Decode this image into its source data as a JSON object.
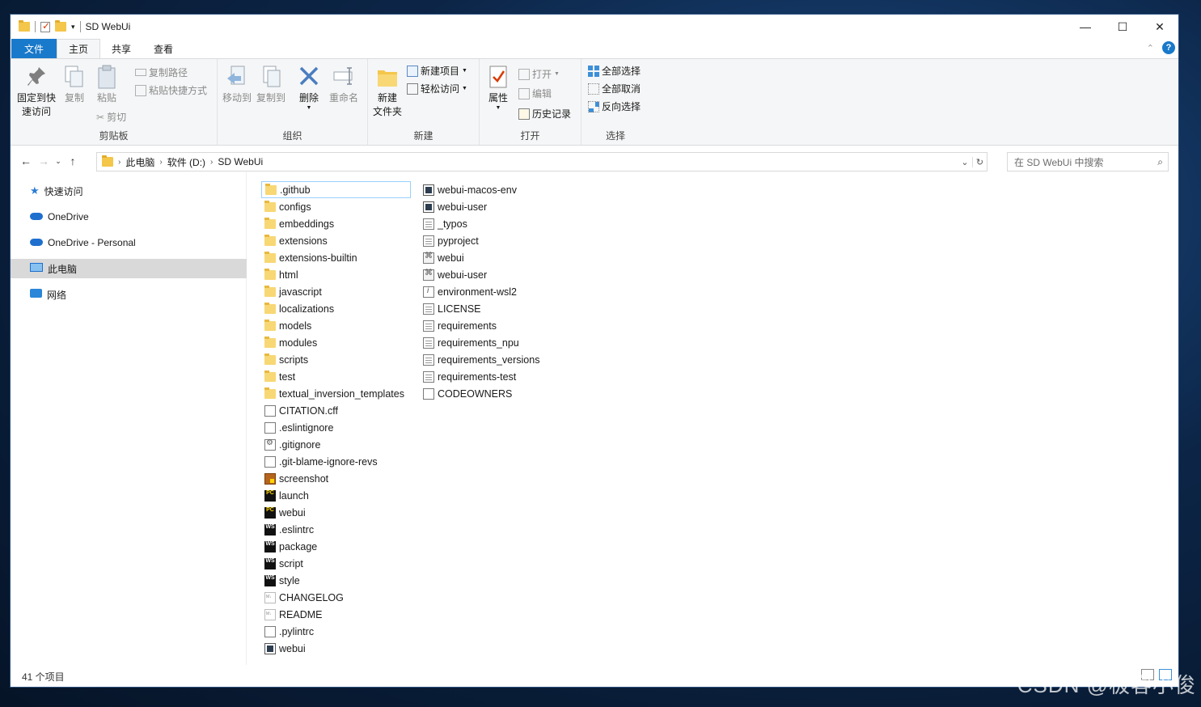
{
  "window": {
    "title": "SD WebUi",
    "controls": {
      "minimize": "—",
      "maximize": "☐",
      "close": "✕"
    }
  },
  "ribbon_tabs": [
    "文件",
    "主页",
    "共享",
    "查看"
  ],
  "ribbon": {
    "clipboard": {
      "pin": "固定到快速访问",
      "copy": "复制",
      "paste": "粘贴",
      "copy_path": "复制路径",
      "paste_shortcut": "粘贴快捷方式",
      "cut": "剪切",
      "label": "剪贴板"
    },
    "organize": {
      "move_to": "移动到",
      "copy_to": "复制到",
      "delete": "删除",
      "rename": "重命名",
      "label": "组织"
    },
    "new": {
      "new_folder_line1": "新建",
      "new_folder_line2": "文件夹",
      "new_item": "新建项目",
      "easy_access": "轻松访问",
      "label": "新建"
    },
    "open": {
      "properties": "属性",
      "open": "打开",
      "edit": "编辑",
      "history": "历史记录",
      "label": "打开"
    },
    "select": {
      "select_all": "全部选择",
      "select_none": "全部取消",
      "invert": "反向选择",
      "label": "选择"
    }
  },
  "address": {
    "crumbs": [
      "此电脑",
      "软件 (D:)",
      "SD WebUi"
    ],
    "search_placeholder": "在 SD WebUi 中搜索"
  },
  "nav_pane": [
    {
      "label": "快速访问",
      "icon": "star-icon"
    },
    {
      "label": "OneDrive",
      "icon": "cloud-icon"
    },
    {
      "label": "OneDrive - Personal",
      "icon": "cloud-icon"
    },
    {
      "label": "此电脑",
      "icon": "computer-icon",
      "selected": true
    },
    {
      "label": "网络",
      "icon": "network-icon"
    }
  ],
  "files_col1": [
    {
      "name": ".github",
      "type": "folder",
      "selected": true
    },
    {
      "name": "configs",
      "type": "folder"
    },
    {
      "name": "embeddings",
      "type": "folder"
    },
    {
      "name": "extensions",
      "type": "folder"
    },
    {
      "name": "extensions-builtin",
      "type": "folder"
    },
    {
      "name": "html",
      "type": "folder"
    },
    {
      "name": "javascript",
      "type": "folder"
    },
    {
      "name": "localizations",
      "type": "folder"
    },
    {
      "name": "models",
      "type": "folder"
    },
    {
      "name": "modules",
      "type": "folder"
    },
    {
      "name": "scripts",
      "type": "folder"
    },
    {
      "name": "test",
      "type": "folder"
    },
    {
      "name": "textual_inversion_templates",
      "type": "folder"
    },
    {
      "name": "CITATION.cff",
      "type": "blank"
    },
    {
      "name": ".eslintignore",
      "type": "blank"
    },
    {
      "name": ".gitignore",
      "type": "gear"
    },
    {
      "name": ".git-blame-ignore-revs",
      "type": "blank"
    },
    {
      "name": "screenshot",
      "type": "pic"
    },
    {
      "name": "launch",
      "type": "pc"
    },
    {
      "name": "webui",
      "type": "pc"
    },
    {
      "name": ".eslintrc",
      "type": "ws"
    },
    {
      "name": "package",
      "type": "ws"
    },
    {
      "name": "script",
      "type": "ws"
    },
    {
      "name": "style",
      "type": "ws"
    },
    {
      "name": "CHANGELOG",
      "type": "md"
    },
    {
      "name": "README",
      "type": "md"
    },
    {
      "name": ".pylintrc",
      "type": "blank"
    },
    {
      "name": "webui",
      "type": "bat"
    }
  ],
  "files_col2": [
    {
      "name": "webui-macos-env",
      "type": "bat"
    },
    {
      "name": "webui-user",
      "type": "bat"
    },
    {
      "name": "_typos",
      "type": "doc"
    },
    {
      "name": "pyproject",
      "type": "doc"
    },
    {
      "name": "webui",
      "type": "script"
    },
    {
      "name": "webui-user",
      "type": "script"
    },
    {
      "name": "environment-wsl2",
      "type": "ital"
    },
    {
      "name": "LICENSE",
      "type": "doc"
    },
    {
      "name": "requirements",
      "type": "doc"
    },
    {
      "name": "requirements_npu",
      "type": "doc"
    },
    {
      "name": "requirements_versions",
      "type": "doc"
    },
    {
      "name": "requirements-test",
      "type": "doc"
    },
    {
      "name": "CODEOWNERS",
      "type": "blank"
    }
  ],
  "status": {
    "count": "41 个项目"
  },
  "watermark": "CSDN @极客小俊",
  "colors": {
    "accent": "#1979ca",
    "folder": "#f8d775",
    "selection": "#99d1ff"
  }
}
